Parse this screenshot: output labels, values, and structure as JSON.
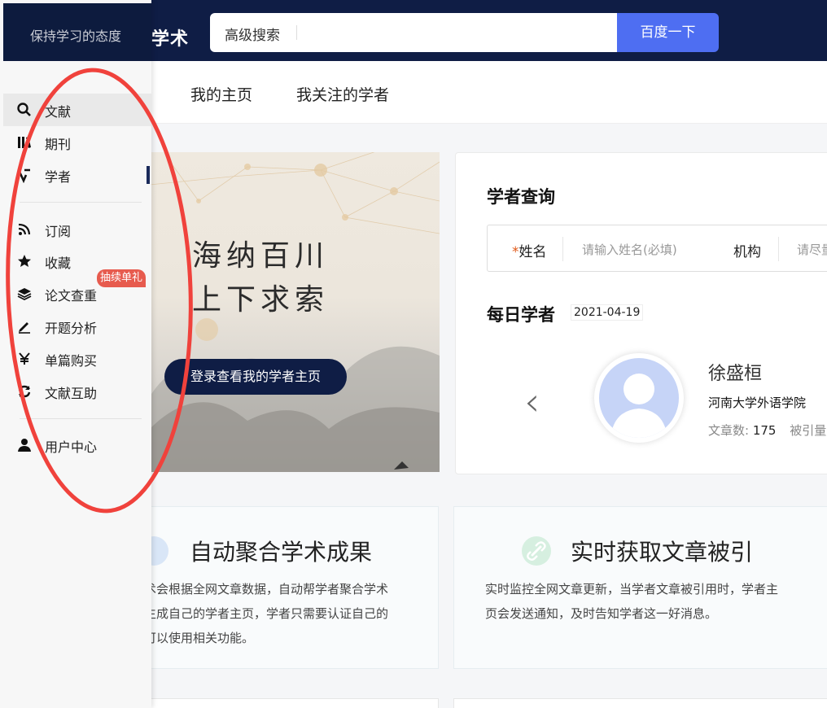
{
  "header": {
    "logo_text": "学术",
    "search_placeholder": "高级搜索",
    "search_button": "百度一下"
  },
  "nav": {
    "tabs": [
      "我的主页",
      "我关注的学者"
    ]
  },
  "hero": {
    "line1": "海纳百川",
    "line2": "上下求索",
    "button": "登录查看我的学者主页"
  },
  "scholar_query": {
    "title": "学者查询",
    "name_label": "姓名",
    "name_placeholder": "请输入姓名(必填)",
    "org_label": "机构",
    "org_placeholder": "请尽量"
  },
  "daily_scholar": {
    "title": "每日学者",
    "date": "2021-04-19",
    "name": "徐盛桓",
    "org": "河南大学外语学院",
    "articles_label": "文章数:",
    "articles_count": "175",
    "cited_label": "被引量"
  },
  "features": [
    {
      "title": "自动聚合学术成果",
      "desc": [
        "术会根据全网文章数据，自动帮学者聚合学术",
        "生成自己的学者主页，学者只需要认证自己的",
        "可以使用相关功能。"
      ],
      "icon": "document-icon",
      "icon_color": "#d9e6f7"
    },
    {
      "title": "实时获取文章被引",
      "desc": [
        "实时监控全网文章更新，当学者文章被引用时，学者主",
        "页会发送通知，及时告知学者这一好消息。"
      ],
      "icon": "link-icon",
      "icon_color": "#d6efe0"
    }
  ],
  "sidebar": {
    "motto": "保持学习的态度",
    "items": [
      {
        "label": "文献",
        "icon": "search-icon"
      },
      {
        "label": "期刊",
        "icon": "journal-icon"
      },
      {
        "label": "学者",
        "icon": "scholar-icon"
      },
      {
        "label": "订阅",
        "icon": "rss-icon"
      },
      {
        "label": "收藏",
        "icon": "star-icon"
      },
      {
        "label": "论文查重",
        "icon": "layers-icon"
      },
      {
        "label": "开题分析",
        "icon": "pencil-icon"
      },
      {
        "label": "单篇购买",
        "icon": "yen-icon"
      },
      {
        "label": "文献互助",
        "icon": "refresh-icon"
      },
      {
        "label": "用户中心",
        "icon": "user-icon"
      }
    ],
    "badge": "抽续单礼"
  },
  "colors": {
    "navy": "#0f1d45",
    "accent": "#4e6ef2",
    "annotation": "#f0423c",
    "badge": "#e75b4e"
  }
}
